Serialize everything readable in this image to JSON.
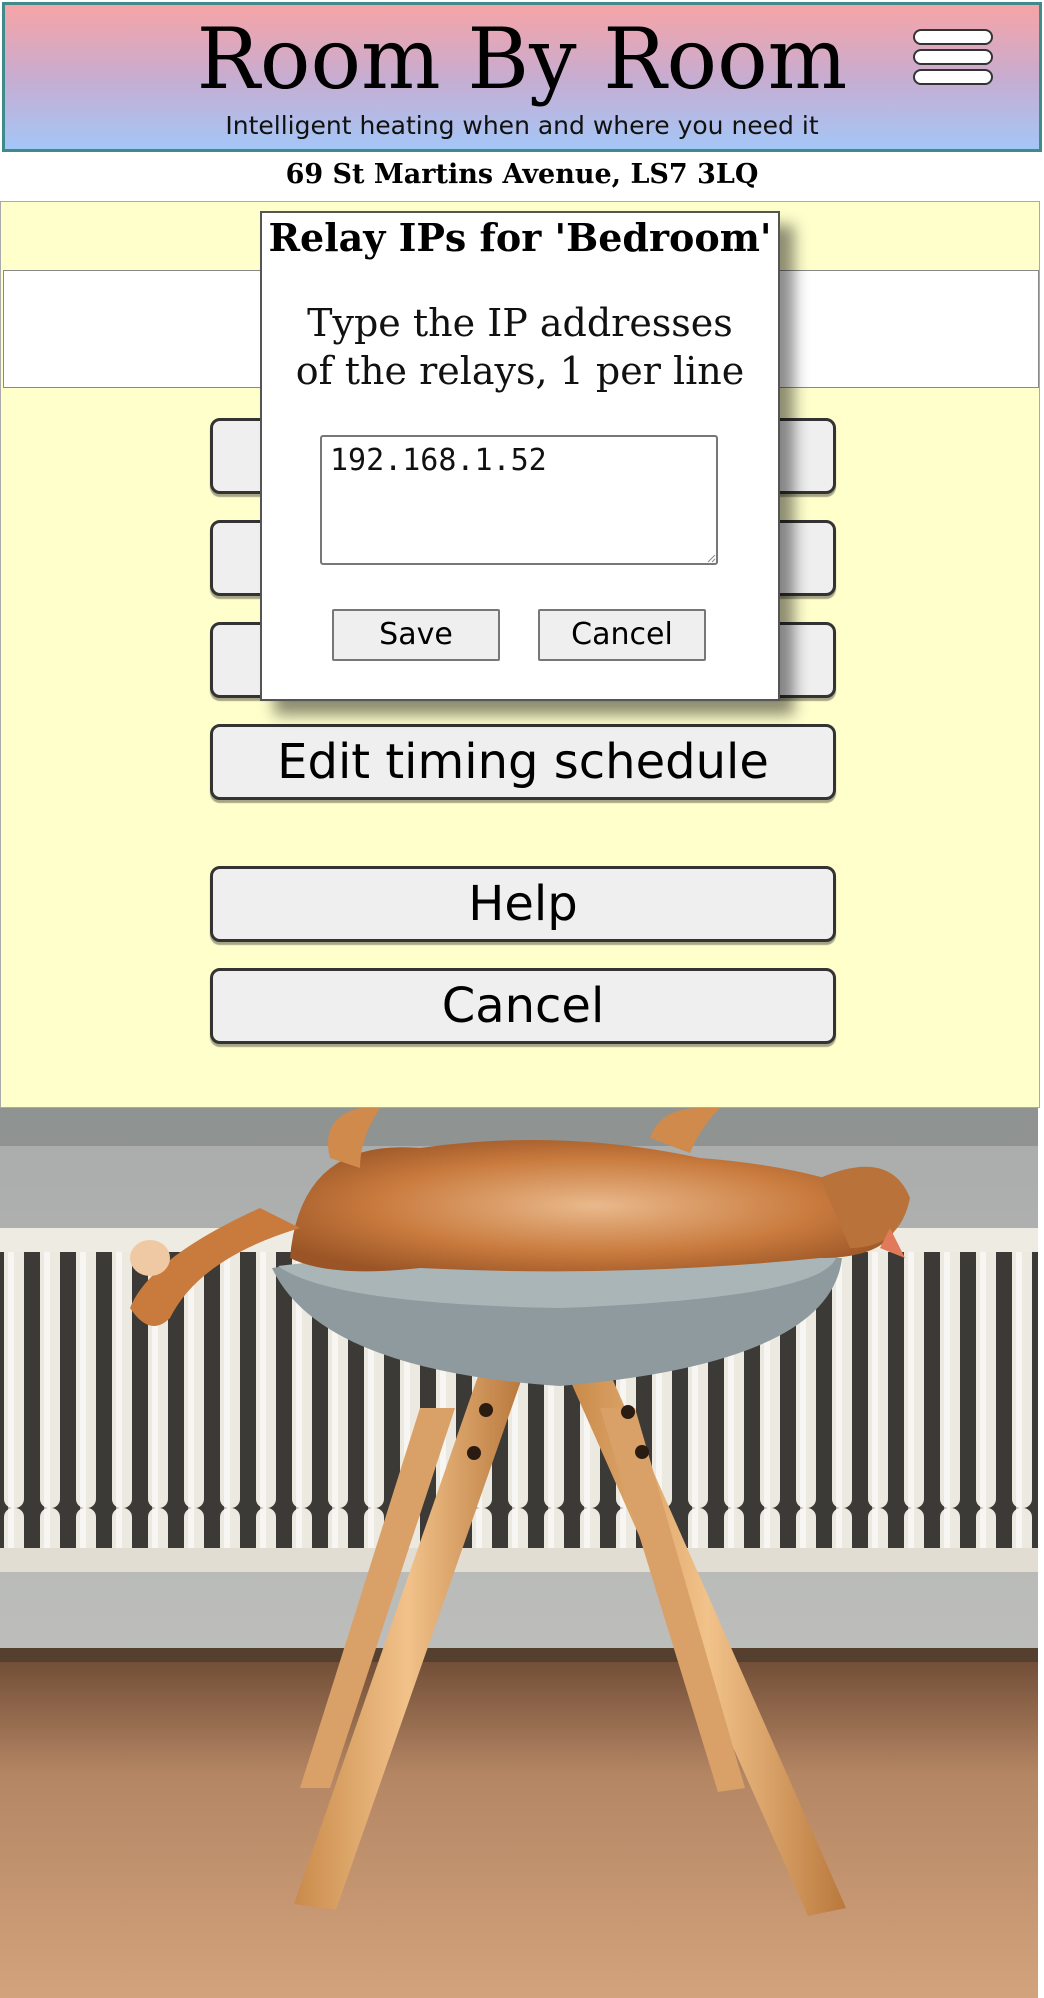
{
  "header": {
    "title": "Room By Room",
    "subtitle": "Intelligent heating when and where you need it",
    "menu_icon": "hamburger-menu-icon"
  },
  "address": "69 St Martins Avenue, LS7 3LQ",
  "menu": {
    "buttons": [
      "",
      "",
      "",
      "Edit timing schedule",
      "Help",
      "Cancel"
    ]
  },
  "dialog": {
    "title": "Relay IPs for 'Bedroom'",
    "instructions_line1": "Type the IP addresses",
    "instructions_line2": "of the relays, 1 per line",
    "ip_text": "192.168.1.52",
    "save_label": "Save",
    "cancel_label": "Cancel"
  },
  "colors": {
    "panel_background": "#ffffcc",
    "header_gradient_top": "#f7a4a6",
    "header_gradient_bottom": "#a4c6f7",
    "header_border": "#3f8a8a"
  }
}
